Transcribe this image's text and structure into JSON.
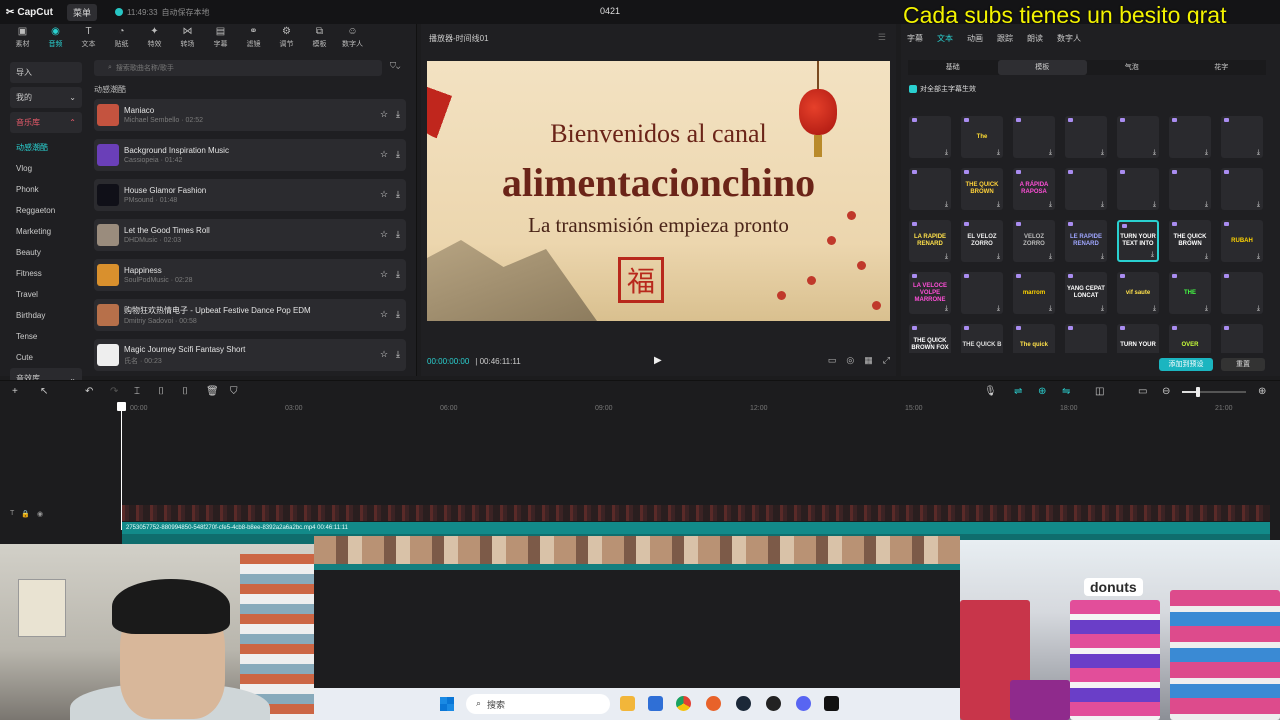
{
  "titlebar": {
    "app": "CapCut",
    "menu": "菜单",
    "save_time": "11:49:33",
    "save_status": "自动保存本地",
    "project": "0421"
  },
  "banner": "Cada subs tienes un besito grat",
  "toolbar": [
    "素材",
    "音频",
    "文本",
    "贴纸",
    "特效",
    "转场",
    "字幕",
    "滤镜",
    "调节",
    "模板",
    "数字人"
  ],
  "left": {
    "import": "导入",
    "mine": "我的",
    "music_lib": "音乐库",
    "categories": [
      "动感潮酷",
      "Vlog",
      "Phonk",
      "Reggaeton",
      "Marketing",
      "Beauty",
      "Fitness",
      "Travel",
      "Birthday",
      "Tense",
      "Cute"
    ],
    "sfx": "音效库",
    "search_placeholder": "搜索歌曲名称/歌手",
    "section_title": "动感潮酷",
    "tracks": [
      {
        "name": "Maniaco",
        "meta": "Michael Sembello · 02:52",
        "color": "#c4533f"
      },
      {
        "name": "Background Inspiration Music",
        "meta": "Cassiopeia · 01:42",
        "color": "#6a3fb8"
      },
      {
        "name": "House Glamor Fashion",
        "meta": "PMsound · 01:48",
        "color": "#101018"
      },
      {
        "name": "Let the Good Times Roll",
        "meta": "DHDMusic · 02:03",
        "color": "#9a8c7d"
      },
      {
        "name": "Happiness",
        "meta": "SoulPodMusic · 02:28",
        "color": "#d9902d"
      },
      {
        "name": "购物狂欢热情电子 - Upbeat Festive Dance Pop EDM",
        "meta": "Dmitriy Sadovoi · 00:58",
        "color": "#b7704a"
      },
      {
        "name": "Magic Journey Scifi Fantasy Short",
        "meta": "氏名 · 00:23",
        "color": "#eeeeee"
      }
    ]
  },
  "player": {
    "header": "播放器-时间线01",
    "line1": "Bienvenidos al canal",
    "line2": "alimentacionchino",
    "line3": "La transmisión empieza pronto",
    "seal": "福",
    "time_current": "00:00:00:00",
    "time_total": "00:46:11:11"
  },
  "right": {
    "tabs": [
      "字幕",
      "文本",
      "动画",
      "跟踪",
      "朗读",
      "数字人"
    ],
    "subtabs": [
      "基础",
      "模板",
      "气泡",
      "花字"
    ],
    "apply_all": "对全部主字幕生效",
    "templates": [
      {
        "t": "",
        "c": "#ff3fb4"
      },
      {
        "t": "The",
        "c": "#ffdd33"
      },
      {
        "t": "",
        "c": "#ffcc44"
      },
      {
        "t": "",
        "c": "#e04040"
      },
      {
        "t": "",
        "c": "#33ff66"
      },
      {
        "t": "",
        "c": "#ffffff"
      },
      {
        "t": "",
        "c": "#ffffff"
      },
      {
        "t": "",
        "c": "#6688ff"
      },
      {
        "t": "THE QUICK BROWN",
        "c": "#ffd23a"
      },
      {
        "t": "A RÁPIDA RAPOSA",
        "c": "#ff4fd8"
      },
      {
        "t": "",
        "c": "#ff3333"
      },
      {
        "t": "",
        "c": "#888888"
      },
      {
        "t": "",
        "c": "#ffee88"
      },
      {
        "t": "",
        "c": "#cccccc"
      },
      {
        "t": "LA RAPIDE RENARD",
        "c": "#ffe14a"
      },
      {
        "t": "EL VELOZ ZORRO",
        "c": "#eeeeee"
      },
      {
        "t": "VELOZ ZORRO",
        "c": "#bbbbbb"
      },
      {
        "t": "LE RAPIDE RENARD",
        "c": "#9fa6ff"
      },
      {
        "t": "TURN YOUR TEXT INTO",
        "c": "#ffffff"
      },
      {
        "t": "THE QUICK BROWN",
        "c": "#ffffff"
      },
      {
        "t": "RUBAH",
        "c": "#ffd400"
      },
      {
        "t": "LA VELOCE VOLPE MARRONE",
        "c": "#ff4fd8"
      },
      {
        "t": "",
        "c": "#ffd400"
      },
      {
        "t": "marrom",
        "c": "#ffd400"
      },
      {
        "t": "YANG CEPAT LONCAT",
        "c": "#ffffff"
      },
      {
        "t": "vif saute",
        "c": "#ffe14a"
      },
      {
        "t": "THE",
        "c": "#44ff44"
      },
      {
        "t": "",
        "c": "#bbbbbb"
      },
      {
        "t": "THE QUICK BROWN FOX",
        "c": "#ffffff"
      },
      {
        "t": "THE QUICK B",
        "c": "#dddddd"
      },
      {
        "t": "The quick",
        "c": "#ffe14a"
      },
      {
        "t": "",
        "c": "#ff66cc"
      },
      {
        "t": "TURN YOUR",
        "c": "#ffffff"
      },
      {
        "t": "OVER",
        "c": "#c8ff3a"
      },
      {
        "t": "",
        "c": "#dddddd"
      }
    ],
    "add_btn": "添加到预设",
    "reset_btn": "重置"
  },
  "timeline": {
    "ruler": [
      "00:00",
      "03:00",
      "06:00",
      "09:00",
      "12:00",
      "15:00",
      "18:00",
      "21:00"
    ],
    "clip_label": "2753057752-880994850-548f270f-cfe5-4cb8-b8ee-8392a2a6a2bc.mp4   00:46:11:11"
  },
  "overlays": {
    "store_sign": "donuts",
    "taskbar_search": "搜索"
  }
}
